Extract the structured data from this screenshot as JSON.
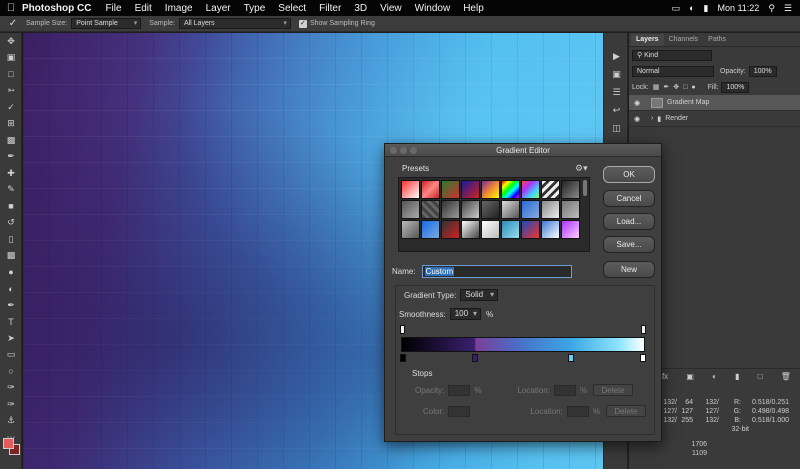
{
  "menubar": {
    "apple_icon": "apple-logo",
    "app_name": "Photoshop CC",
    "items": [
      "File",
      "Edit",
      "Image",
      "Layer",
      "Type",
      "Select",
      "Filter",
      "3D",
      "View",
      "Window",
      "Help"
    ],
    "clock": "Mon 11:22"
  },
  "options": {
    "tool_icon": "eyedropper-icon",
    "sample_size_label": "Sample Size:",
    "sample_size_value": "Point Sample",
    "sample_label": "Sample:",
    "sample_value": "All Layers",
    "show_ring_label": "Show Sampling Ring",
    "show_ring_checked": true
  },
  "layers_panel": {
    "tabs": [
      "Layers",
      "Channels",
      "Paths"
    ],
    "active_tab": "Layers",
    "filter_value": "Kind",
    "blend_mode": "Normal",
    "opacity_label": "Opacity:",
    "opacity_value": "100%",
    "lock_label": "Lock:",
    "fill_label": "Fill:",
    "fill_value": "100%",
    "layers": [
      {
        "name": "Gradient Map",
        "visible": true,
        "selected": true
      },
      {
        "name": "Render",
        "visible": true,
        "selected": false
      }
    ]
  },
  "info_panel": {
    "rows": [
      {
        "a": "132/",
        "b": "64",
        "c": "132/",
        "d": "R:",
        "e": "0.518/0.251"
      },
      {
        "a": "127/",
        "b": "127",
        "c": "127/",
        "d": "G:",
        "e": "0.498/0.498"
      },
      {
        "a": "132/",
        "b": "255",
        "c": "132/",
        "d": "B:",
        "e": "0.518/1.000"
      }
    ],
    "bit_depth": "32-bit",
    "w": "1706",
    "h": "1109"
  },
  "dialog": {
    "title": "Gradient Editor",
    "presets_label": "Presets",
    "ok": "OK",
    "cancel": "Cancel",
    "load": "Load...",
    "save": "Save...",
    "new": "New",
    "name_label": "Name:",
    "name_value": "Custom",
    "gradient_type_label": "Gradient Type:",
    "gradient_type_value": "Solid",
    "smoothness_label": "Smoothness:",
    "smoothness_value": "100",
    "smoothness_unit": "%",
    "stops_label": "Stops",
    "opacity_label": "Opacity:",
    "color_label": "Color:",
    "location_label": "Location:",
    "pct": "%",
    "delete_label": "Delete"
  },
  "colors": {
    "foreground": "#e45d5d",
    "background": "#7a2424",
    "accent": "#2f6fb5"
  }
}
